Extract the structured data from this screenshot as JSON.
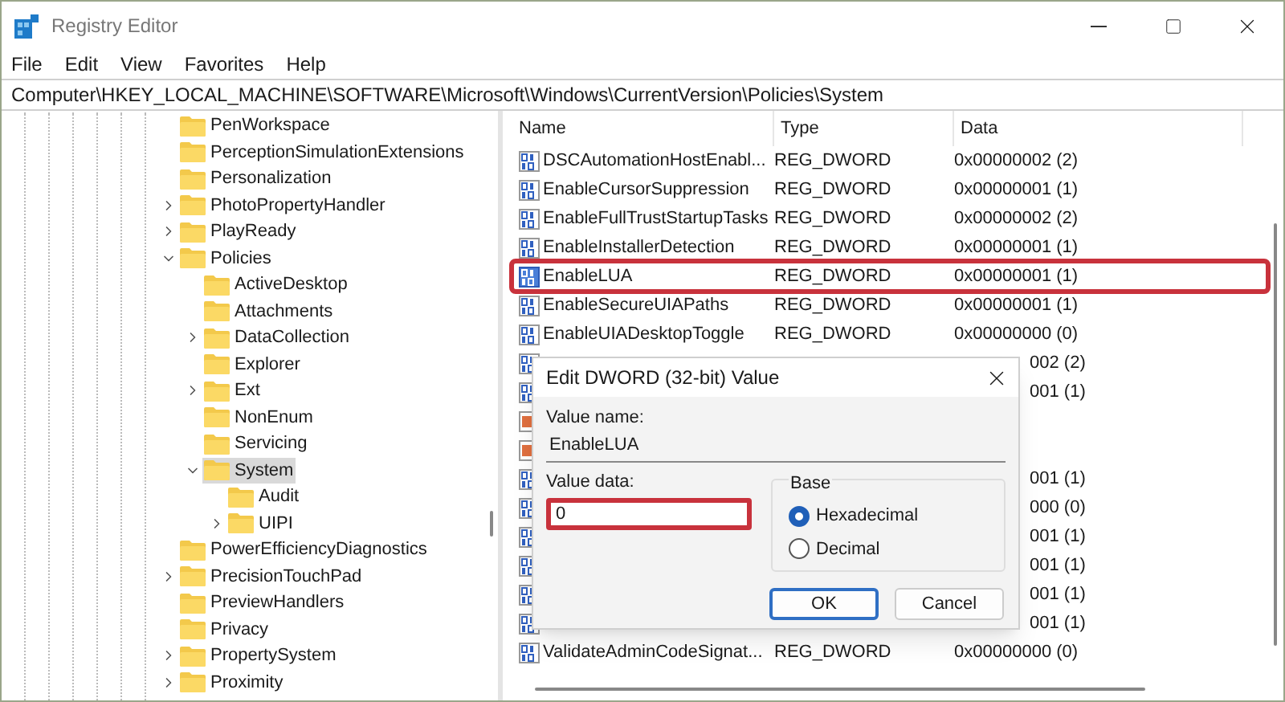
{
  "window": {
    "title": "Registry Editor"
  },
  "menu": [
    "File",
    "Edit",
    "View",
    "Favorites",
    "Help"
  ],
  "address": "Computer\\HKEY_LOCAL_MACHINE\\SOFTWARE\\Microsoft\\Windows\\CurrentVersion\\Policies\\System",
  "tree": [
    {
      "name": "PenWorkspace",
      "selected": false
    },
    {
      "name": "PerceptionSimulationExtensions",
      "selected": false
    },
    {
      "name": "Personalization",
      "selected": false
    },
    {
      "name": "PhotoPropertyHandler",
      "expanded": false,
      "selected": false
    },
    {
      "name": "PlayReady",
      "expanded": false,
      "selected": false
    },
    {
      "name": "Policies",
      "expanded": true,
      "selected": false,
      "children": [
        {
          "name": "ActiveDesktop",
          "selected": false
        },
        {
          "name": "Attachments",
          "selected": false
        },
        {
          "name": "DataCollection",
          "expanded": false,
          "selected": false
        },
        {
          "name": "Explorer",
          "selected": false
        },
        {
          "name": "Ext",
          "expanded": false,
          "selected": false
        },
        {
          "name": "NonEnum",
          "selected": false
        },
        {
          "name": "Servicing",
          "selected": false
        },
        {
          "name": "System",
          "expanded": true,
          "selected": true,
          "children": [
            {
              "name": "Audit",
              "selected": false
            },
            {
              "name": "UIPI",
              "expanded": false,
              "selected": false
            }
          ]
        }
      ]
    },
    {
      "name": "PowerEfficiencyDiagnostics",
      "selected": false
    },
    {
      "name": "PrecisionTouchPad",
      "expanded": false,
      "selected": false
    },
    {
      "name": "PreviewHandlers",
      "selected": false
    },
    {
      "name": "Privacy",
      "selected": false
    },
    {
      "name": "PropertySystem",
      "expanded": false,
      "selected": false
    },
    {
      "name": "Proximity",
      "expanded": false,
      "selected": false
    }
  ],
  "values": {
    "columns": [
      "Name",
      "Type",
      "Data"
    ],
    "rows": [
      {
        "kind": "dword",
        "name": "DSCAutomationHostEnabl...",
        "type": "REG_DWORD",
        "data": "0x00000002 (2)",
        "selected": false,
        "highlighted": false
      },
      {
        "kind": "dword",
        "name": "EnableCursorSuppression",
        "type": "REG_DWORD",
        "data": "0x00000001 (1)",
        "selected": false,
        "highlighted": false
      },
      {
        "kind": "dword",
        "name": "EnableFullTrustStartupTasks",
        "type": "REG_DWORD",
        "data": "0x00000002 (2)",
        "selected": false,
        "highlighted": false
      },
      {
        "kind": "dword",
        "name": "EnableInstallerDetection",
        "type": "REG_DWORD",
        "data": "0x00000001 (1)",
        "selected": false,
        "highlighted": false
      },
      {
        "kind": "dword",
        "name": "EnableLUA",
        "type": "REG_DWORD",
        "data": "0x00000001 (1)",
        "selected": true,
        "highlighted": true
      },
      {
        "kind": "dword",
        "name": "EnableSecureUIAPaths",
        "type": "REG_DWORD",
        "data": "0x00000001 (1)",
        "selected": false,
        "highlighted": false
      },
      {
        "kind": "dword",
        "name": "EnableUIADesktopToggle",
        "type": "REG_DWORD",
        "data": "0x00000000 (0)",
        "selected": false,
        "highlighted": false
      },
      {
        "kind": "dword",
        "data": "002 (2)",
        "selected": false,
        "highlighted": false
      },
      {
        "kind": "dword",
        "data": "001 (1)",
        "selected": false,
        "highlighted": false
      },
      {
        "kind": "string",
        "selected": false,
        "highlighted": false
      },
      {
        "kind": "string",
        "selected": false,
        "highlighted": false
      },
      {
        "kind": "dword",
        "data": "001 (1)",
        "selected": false,
        "highlighted": false
      },
      {
        "kind": "dword",
        "data": "000 (0)",
        "selected": false,
        "highlighted": false
      },
      {
        "kind": "dword",
        "data": "001 (1)",
        "selected": false,
        "highlighted": false
      },
      {
        "kind": "dword",
        "data": "001 (1)",
        "selected": false,
        "highlighted": false
      },
      {
        "kind": "dword",
        "data": "001 (1)",
        "selected": false,
        "highlighted": false
      },
      {
        "kind": "dword",
        "data": "001 (1)",
        "selected": false,
        "highlighted": false
      },
      {
        "kind": "dword",
        "name": "ValidateAdminCodeSignat...",
        "type": "REG_DWORD",
        "data": "0x00000000 (0)",
        "selected": false,
        "highlighted": false
      }
    ]
  },
  "dialog": {
    "title": "Edit DWORD (32-bit) Value",
    "value_name_label": "Value name:",
    "value_name": "EnableLUA",
    "value_data_label": "Value data:",
    "value_data": "0",
    "value_data_highlighted": true,
    "base_label": "Base",
    "bases": [
      {
        "label": "Hexadecimal",
        "selected": true
      },
      {
        "label": "Decimal",
        "selected": false
      }
    ],
    "buttons": [
      {
        "label": "OK",
        "default": true
      },
      {
        "label": "Cancel",
        "default": false
      }
    ]
  }
}
